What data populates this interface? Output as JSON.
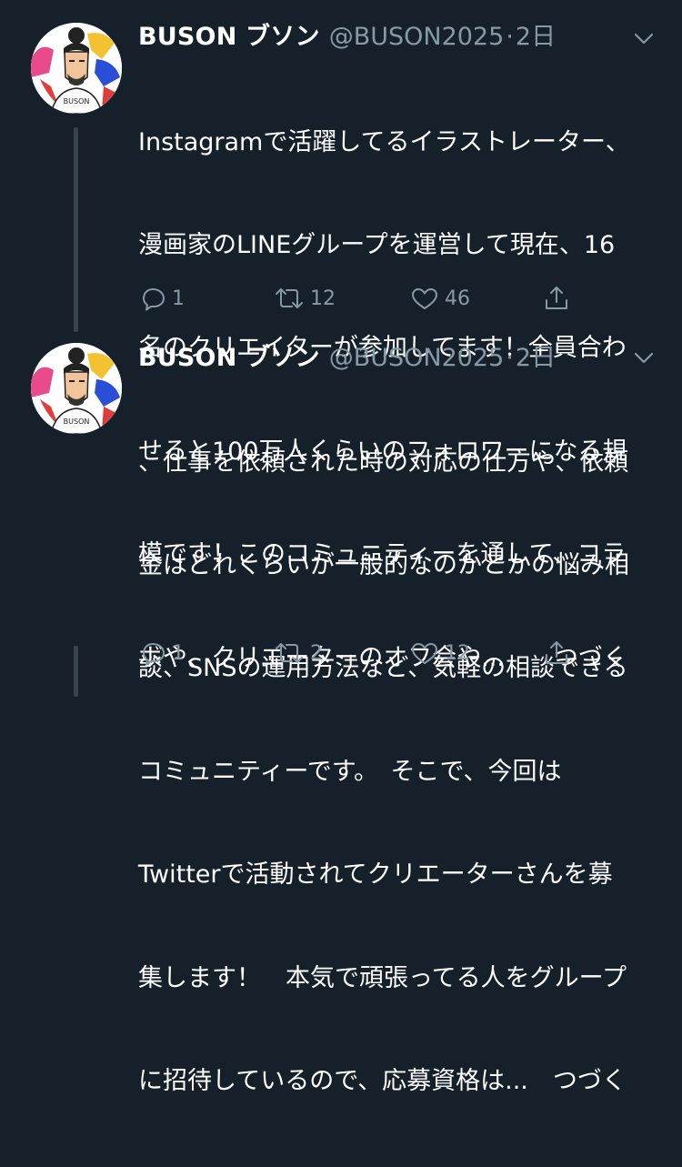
{
  "tweets": [
    {
      "display_name": "BUSON ブソン",
      "handle": "@BUSON2025",
      "separator": "·",
      "time": "2日",
      "text_lines": [
        "Instagramで活躍してるイラストレーター、",
        "漫画家のLINEグループを運営して現在、16",
        "名のクリエイターが参加してます！全員合わ",
        "せると100万人くらいのフォロワーになる規",
        "模です！このコミュニティーを通して、コラ",
        "ボや、クリエーターのオフ会や...　　つづく"
      ],
      "avatar_label": "BUSON",
      "replies": "1",
      "retweets": "12",
      "likes": "46"
    },
    {
      "display_name": "BUSON ブソン",
      "handle": "@BUSON2025",
      "separator": "·",
      "time": "2日",
      "text_lines": [
        "、仕事を依頼された時の対応の仕方や、依頼",
        "金はどれくらいが一般的なのかとかの悩み相",
        "談、SNSの運用方法など、気軽の相談できる",
        "コミュニティーです。　そこで、今回は",
        "Twitterで活動されてクリエーターさんを募",
        "集します！　本気で頑張ってる人をグループ",
        "に招待しているので、応募資格は...　つづく"
      ],
      "avatar_label": "BUSON",
      "replies": "1",
      "retweets": "2",
      "likes": "12"
    }
  ],
  "icons": {
    "reply": "reply-icon",
    "retweet": "retweet-icon",
    "like": "heart-icon",
    "share": "share-icon",
    "more": "chevron-down-icon"
  },
  "colors": {
    "background": "#15202b",
    "secondary_text": "#8899a6",
    "thread_line": "#38444d"
  }
}
